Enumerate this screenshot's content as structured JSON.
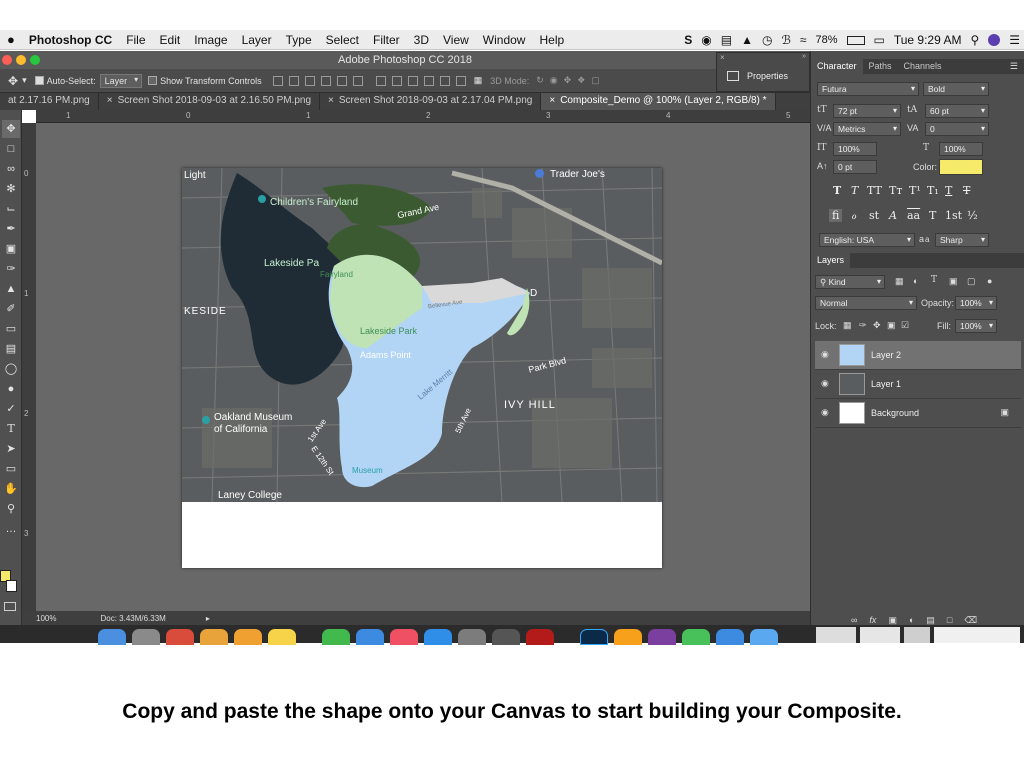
{
  "menubar": {
    "apple": "",
    "app_name": "Photoshop CC",
    "items": [
      "File",
      "Edit",
      "Image",
      "Layer",
      "Type",
      "Select",
      "Filter",
      "3D",
      "View",
      "Window",
      "Help"
    ],
    "battery": "78%",
    "clock": "Tue 9:29 AM"
  },
  "window": {
    "title": "Adobe Photoshop CC 2018"
  },
  "options_bar": {
    "auto_select_label": "Auto-Select:",
    "auto_select_value": "Layer",
    "transform_label": "Show Transform Controls",
    "mode_3d_label": "3D Mode:"
  },
  "properties_panel": {
    "label": "Properties"
  },
  "tabs": [
    {
      "label": "at 2.17.16 PM.png",
      "active": false
    },
    {
      "label": "Screen Shot 2018-09-03 at 2.16.50 PM.png",
      "active": false
    },
    {
      "label": "Screen Shot 2018-09-03 at 2.17.04 PM.png",
      "active": false
    },
    {
      "label": "Composite_Demo @ 100% (Layer 2, RGB/8) *",
      "active": true
    }
  ],
  "ruler": {
    "h": [
      "1",
      "0",
      "1",
      "2",
      "3",
      "4",
      "5"
    ],
    "v": [
      "0",
      "1",
      "2",
      "3"
    ]
  },
  "map": {
    "labels": {
      "light": "Light",
      "childrens_fairyland": "Children's Fairyland",
      "trader_joes": "Trader Joe's",
      "grand_ave": "Grand Ave",
      "lakeside_park_left": "Lakeside Pa",
      "fairyland": "Fairyland",
      "bellevue_ave": "Bellevue Ave",
      "lakeside_park": "Lakeside Park",
      "adams_point": "Adams Point",
      "lakeside_district": "KESIDE",
      "lake_merritt": "Lake Merritt",
      "park_blvd": "Park Blvd",
      "ivy_hill": "IVY HILL",
      "oakland_museum_1": "Oakland Museum",
      "oakland_museum_2": "of California",
      "museum": "Museum",
      "laney_college": "Laney College",
      "first_ave": "1st Ave",
      "e_12th_st": "E 12th St",
      "fifth_ave": "5th Ave",
      "d_letter": "D"
    }
  },
  "status_bar": {
    "zoom": "100%",
    "doc": "Doc: 3.43M/6.33M"
  },
  "character_panel": {
    "tabs": [
      "Character",
      "Paths",
      "Channels"
    ],
    "font_family": "Futura",
    "font_style": "Bold",
    "font_size": "72 pt",
    "leading": "60 pt",
    "kerning": "Metrics",
    "tracking": "0",
    "vertical_scale": "100%",
    "horizontal_scale": "100%",
    "baseline_shift": "0 pt",
    "color_label": "Color:",
    "color": "#f6ea6a",
    "language": "English: USA",
    "aa_label": "a",
    "anti_alias": "Sharp"
  },
  "layers_panel": {
    "title": "Layers",
    "filter": "Kind",
    "blend_mode": "Normal",
    "opacity_label": "Opacity:",
    "opacity": "100%",
    "lock_label": "Lock:",
    "fill_label": "Fill:",
    "fill": "100%",
    "layers": [
      {
        "name": "Layer 2",
        "selected": true
      },
      {
        "name": "Layer 1",
        "selected": false
      },
      {
        "name": "Background",
        "selected": false
      }
    ]
  },
  "caption": "Copy and paste the shape onto your Canvas to start building your Composite."
}
